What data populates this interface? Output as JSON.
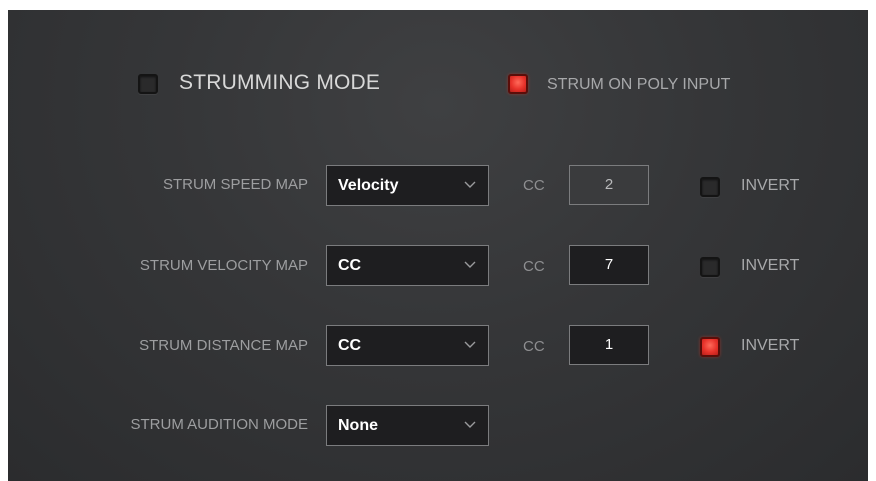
{
  "header": {
    "strumming_mode": {
      "label": "STRUMMING MODE",
      "checked": false
    },
    "strum_on_poly_input": {
      "label": "STRUM ON POLY INPUT",
      "checked": true
    }
  },
  "rows": [
    {
      "label": "STRUM SPEED MAP",
      "dropdown": "Velocity",
      "cc_label": "CC",
      "cc_value": "2",
      "invert_label": "INVERT",
      "invert_checked": false
    },
    {
      "label": "STRUM VELOCITY MAP",
      "dropdown": "CC",
      "cc_label": "CC",
      "cc_value": "7",
      "invert_label": "INVERT",
      "invert_checked": false
    },
    {
      "label": "STRUM DISTANCE MAP",
      "dropdown": "CC",
      "cc_label": "CC",
      "cc_value": "1",
      "invert_label": "INVERT",
      "invert_checked": true
    },
    {
      "label": "STRUM AUDITION MODE",
      "dropdown": "None"
    }
  ],
  "colors": {
    "panel_background": "#353638",
    "checkbox_active": "#e8322a",
    "field_border": "#7b7c7e"
  },
  "icons": {
    "dropdown_arrow": "chevron-down-icon"
  }
}
